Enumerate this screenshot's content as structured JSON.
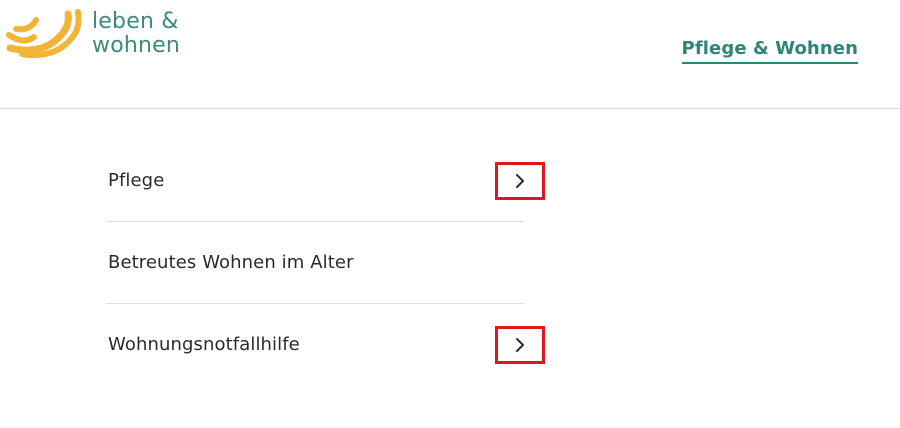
{
  "brand": {
    "name_line1": "leben &",
    "name_line2": "wohnen",
    "colors": {
      "mark": "#f3b337",
      "text": "#3d8a7c"
    }
  },
  "header": {
    "nav_link": "Pflege & Wohnen"
  },
  "menu": {
    "items": [
      {
        "label": "Pflege",
        "has_submenu": true,
        "icon": "chevron-right-icon"
      },
      {
        "label": "Betreutes Wohnen im Alter",
        "has_submenu": false
      },
      {
        "label": "Wohnungsnotfallhilfe",
        "has_submenu": true,
        "icon": "chevron-right-icon"
      }
    ]
  },
  "colors": {
    "accent": "#2f8479",
    "highlight_border": "#e0161d",
    "divider": "#dedede"
  }
}
